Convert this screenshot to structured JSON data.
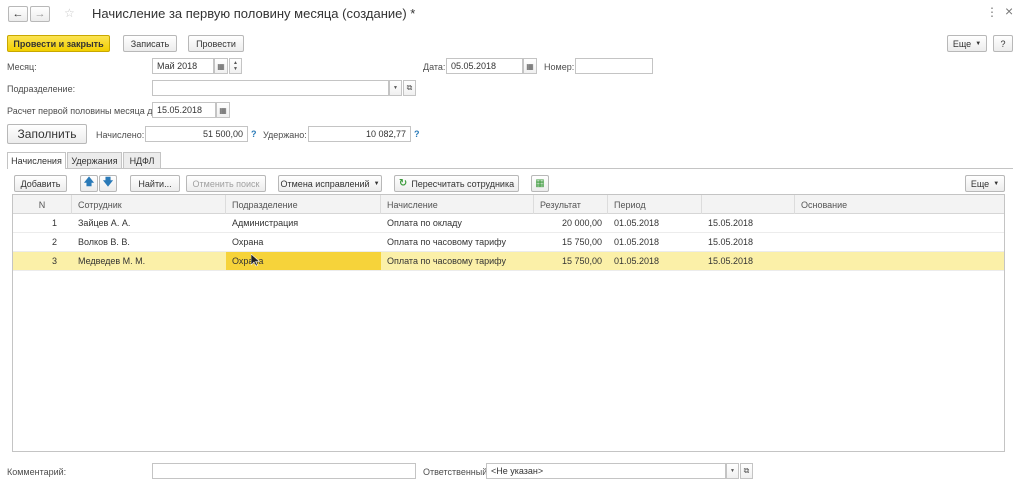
{
  "window": {
    "title": "Начисление за первую половину месяца (создание) *",
    "more_label": "Еще",
    "help_label": "?",
    "close_label": "×",
    "menu_label": "⋮"
  },
  "toolbar": {
    "post_close_label": "Провести и закрыть",
    "save_label": "Записать",
    "post_label": "Провести"
  },
  "form": {
    "month_label": "Месяц:",
    "month_value": "Май 2018",
    "date_label": "Дата:",
    "date_value": "05.05.2018",
    "number_label": "Номер:",
    "number_value": "",
    "division_label": "Подразделение:",
    "division_value": "",
    "calc_label": "Расчет первой половины месяца до:",
    "calc_value": "15.05.2018",
    "fill_label": "Заполнить",
    "accrued_label": "Начислено:",
    "accrued_value": "51 500,00",
    "withheld_label": "Удержано:",
    "withheld_value": "10 082,77"
  },
  "tabs": [
    {
      "label": "Начисления"
    },
    {
      "label": "Удержания"
    },
    {
      "label": "НДФЛ"
    }
  ],
  "grid_toolbar": {
    "add_label": "Добавить",
    "find_label": "Найти...",
    "cancel_search_label": "Отменить поиск",
    "undo_corrections_label": "Отмена исправлений",
    "recalc_label": "Пересчитать сотрудника",
    "more_label": "Еще"
  },
  "table": {
    "headers": [
      "N",
      "Сотрудник",
      "Подразделение",
      "Начисление",
      "Результат",
      "Период",
      "",
      "Основание"
    ],
    "rows": [
      [
        "1",
        "Зайцев А. А.",
        "Администрация",
        "Оплата по окладу",
        "20 000,00",
        "01.05.2018",
        "15.05.2018",
        ""
      ],
      [
        "2",
        "Волков В. В.",
        "Охрана",
        "Оплата по часовому тарифу",
        "15 750,00",
        "01.05.2018",
        "15.05.2018",
        ""
      ],
      [
        "3",
        "Медведев М. М.",
        "Охрана",
        "Оплата по часовому тарифу",
        "15 750,00",
        "01.05.2018",
        "15.05.2018",
        ""
      ]
    ]
  },
  "footer": {
    "comment_label": "Комментарий:",
    "comment_value": "",
    "responsible_label": "Ответственный:",
    "responsible_value": "<Не указан>"
  },
  "colors": {
    "accent_yellow": "#f2cf00",
    "selected_row": "#fbf0a8",
    "current_cell": "#f6d33a",
    "help_blue": "#2a7ab8"
  }
}
